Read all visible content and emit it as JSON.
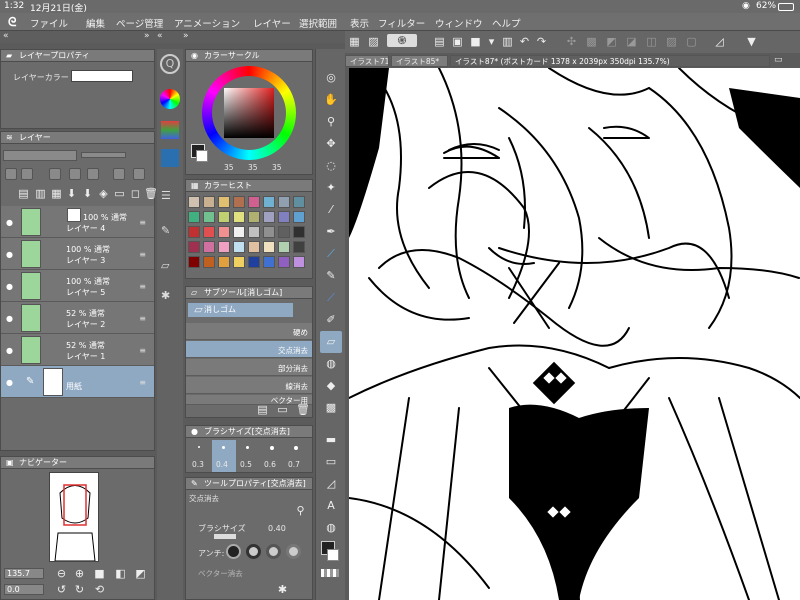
{
  "status": {
    "time": "1:32",
    "date": "12月21日(金)",
    "battery": "62%"
  },
  "menu": [
    "ファイル",
    "編集",
    "ページ管理",
    "アニメーション",
    "レイヤー",
    "選択範囲",
    "表示",
    "フィルター",
    "ウィンドウ",
    "ヘルプ"
  ],
  "layer_property": {
    "title": "レイヤープロパティ",
    "layer_color_label": "レイヤーカラー"
  },
  "layer_panel": {
    "title": "レイヤー",
    "layers": [
      {
        "pct": "100 % 通常",
        "name": "レイヤー 4"
      },
      {
        "pct": "100 % 通常",
        "name": "レイヤー 3"
      },
      {
        "pct": "100 % 通常",
        "name": "レイヤー 5"
      },
      {
        "pct": "52 % 通常",
        "name": "レイヤー 2"
      },
      {
        "pct": "52 % 通常",
        "name": "レイヤー 1"
      },
      {
        "pct": "",
        "name": "用紙"
      }
    ]
  },
  "navigator": {
    "title": "ナビゲーター",
    "zoom": "135.7",
    "angle": "0.0"
  },
  "color_circle": {
    "title": "カラーサークル",
    "values": [
      "35",
      "35",
      "35"
    ]
  },
  "color_history": {
    "title": "カラーヒスト"
  },
  "subtool": {
    "title": "サブツール[消しゴム]",
    "group": "消しゴム",
    "items": [
      "硬め",
      "交点消去",
      "部分消去",
      "線消去",
      "ベクター用"
    ]
  },
  "brush_size": {
    "title": "ブラシサイズ[交点消去]",
    "sizes": [
      "0.3",
      "0.4",
      "0.5",
      "0.6",
      "0.7"
    ]
  },
  "tool_property": {
    "title": "ツールプロパティ[交点消去]",
    "group": "交点消去",
    "brush_size_label": "ブラシサイズ",
    "brush_size_value": "0.40",
    "antialias_label": "アンチ:",
    "vector_label": "ベクター消去"
  },
  "tabs": [
    "イラスト71(...",
    "イラスト85*",
    "イラスト87* (ポストカード 1378 x 2039px 350dpi 135.7%)"
  ],
  "colors": {
    "accent": "#8fa9c2",
    "layer_green": "#9cd69a",
    "panel": "#6b6b6b"
  },
  "swatches": [
    "#d0c0b0",
    "#c8b090",
    "#e0c070",
    "#b07050",
    "#d06090",
    "#70b0d0",
    "#90a0b0",
    "#6090a0",
    "#40b080",
    "#70c090",
    "#c0d070",
    "#e0e080",
    "#b0b070",
    "#a0a0c0",
    "#8080c0",
    "#60a0d0",
    "#c03030",
    "#e05050",
    "#f09090",
    "#f0f0f0",
    "#c0c0c0",
    "#909090",
    "#606060",
    "#303030",
    "#a03050",
    "#d070a0",
    "#f0a0c0",
    "#c0e0f0",
    "#e0c0a0",
    "#f0e0c0",
    "#b0d0b0",
    "#404040",
    "#800000",
    "#c06020",
    "#e0a040",
    "#f0d060",
    "#2040a0",
    "#4070d0",
    "#9060c0",
    "#c090e0"
  ]
}
